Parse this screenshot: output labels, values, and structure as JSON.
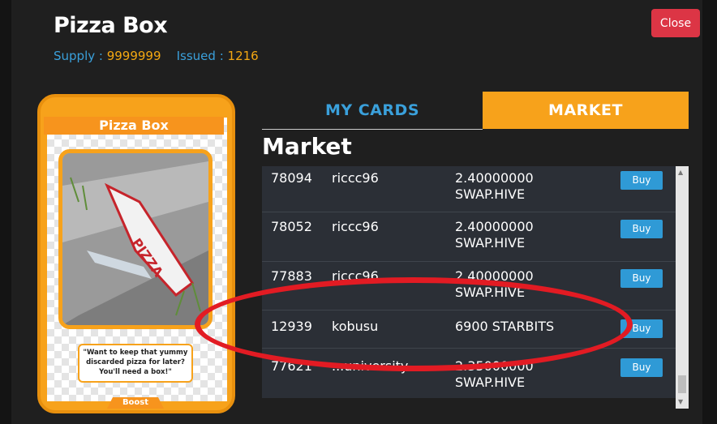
{
  "header": {
    "title": "Pizza Box",
    "supply_label": "Supply :",
    "supply_value": "9999999",
    "issued_label": "Issued :",
    "issued_value": "1216",
    "close_label": "Close"
  },
  "card": {
    "name": "Pizza Box",
    "quote": "\"Want to keep that yummy discarded pizza for later? You'll need a box!\"",
    "boost_label": "Boost",
    "art_text": "PIZZA",
    "box_logo": "PIZZA"
  },
  "tabs": [
    {
      "label": "MY CARDS",
      "active": false
    },
    {
      "label": "MARKET",
      "active": true
    }
  ],
  "market": {
    "heading": "Market",
    "buy_label": "Buy",
    "rows": [
      {
        "id": "78094",
        "seller": "riccc96",
        "price": "2.40000000 SWAP.HIVE"
      },
      {
        "id": "78052",
        "seller": "riccc96",
        "price": "2.40000000 SWAP.HIVE"
      },
      {
        "id": "77883",
        "seller": "riccc96",
        "price": "2.40000000 SWAP.HIVE"
      },
      {
        "id": "12939",
        "seller": "kobusu",
        "price": "6900 STARBITS"
      },
      {
        "id": "77621",
        "seller": "...university",
        "price": "2.35000000 SWAP.HIVE"
      }
    ]
  },
  "colors": {
    "accent_orange": "#f7a21b",
    "accent_blue": "#3aa0db",
    "close_red": "#dc3545",
    "highlight_red": "#e21b23"
  }
}
